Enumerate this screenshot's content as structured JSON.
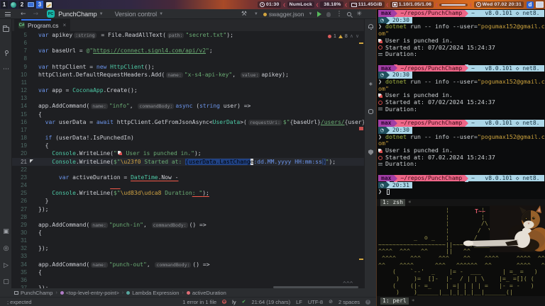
{
  "topbar": {
    "workspaces": [
      {
        "num": "1",
        "icon": "globe-icon",
        "active": false
      },
      {
        "num": "2",
        "icon": "monitor-icon",
        "active": false
      },
      {
        "num": "3",
        "icon": "editor-icon",
        "active": true
      }
    ],
    "status": [
      {
        "icon": "clock-icon",
        "label": "01:30"
      },
      {
        "icon": null,
        "label": "NumLock"
      },
      {
        "icon": "power-icon",
        "label": "38.18%"
      },
      {
        "icon": "disk-icon",
        "label": "111.45GiB"
      },
      {
        "icon": "cpu-icon",
        "label": "1.10/1.05/1.06"
      },
      {
        "icon": "slider-icon",
        "label": ""
      },
      {
        "icon": "clock-icon",
        "label": "Wed 07.02 20:31"
      }
    ],
    "tray": {
      "d_badge": "d"
    }
  },
  "editor": {
    "header": {
      "project": "PunchChamp",
      "project_badge": "PC",
      "vcs": "Version control",
      "run_config": "swagger.json"
    },
    "tab": {
      "name": "Program.cs",
      "close": "×"
    },
    "inspections": {
      "errors": "1",
      "warnings": "8"
    },
    "code": {
      "lines": [
        {
          "n": 5,
          "tokens": [
            [
              "k",
              "var"
            ],
            [
              "v",
              " apikey"
            ],
            [
              "h",
              ":string"
            ],
            [
              "v",
              " = File.ReadAllText("
            ],
            [
              "h",
              "path:"
            ],
            [
              "s",
              "\"secret.txt\""
            ],
            [
              "v",
              ");"
            ]
          ]
        },
        {
          "n": 6,
          "tokens": []
        },
        {
          "n": 7,
          "tokens": [
            [
              "k",
              "var"
            ],
            [
              "v",
              " baseUrl = "
            ],
            [
              "s",
              "@\""
            ],
            [
              "su",
              "https://connect.signl4.com/api/v2"
            ],
            [
              "s",
              "\""
            ],
            [
              "v",
              ";"
            ]
          ]
        },
        {
          "n": 8,
          "tokens": []
        },
        {
          "n": 9,
          "tokens": [
            [
              "k",
              "var"
            ],
            [
              "v",
              " httpClient = "
            ],
            [
              "k",
              "new"
            ],
            [
              "v",
              " "
            ],
            [
              "t",
              "HttpClient"
            ],
            [
              "v",
              "();"
            ]
          ]
        },
        {
          "n": 10,
          "tokens": [
            [
              "v",
              "httpClient.DefaultRequestHeaders.Add("
            ],
            [
              "h",
              "name:"
            ],
            [
              "s",
              "\"x-s4-api-key\""
            ],
            [
              "v",
              ", "
            ],
            [
              "h",
              "value:"
            ],
            [
              "v",
              "apikey);"
            ]
          ]
        },
        {
          "n": 11,
          "tokens": []
        },
        {
          "n": 12,
          "tokens": [
            [
              "k",
              "var"
            ],
            [
              "v",
              " app = "
            ],
            [
              "t",
              "CoconaApp"
            ],
            [
              "v",
              ".Create();"
            ]
          ]
        },
        {
          "n": 13,
          "tokens": []
        },
        {
          "n": 14,
          "tokens": [
            [
              "v",
              "app.AddCommand("
            ],
            [
              "h",
              "name:"
            ],
            [
              "s",
              "\"info\""
            ],
            [
              "v",
              ", "
            ],
            [
              "h",
              "commandBody:"
            ],
            [
              "k",
              "async"
            ],
            [
              "v",
              " ("
            ],
            [
              "k",
              "string"
            ],
            [
              "v",
              " user) =>"
            ]
          ]
        },
        {
          "n": 15,
          "tokens": [
            [
              "v",
              "{"
            ]
          ]
        },
        {
          "n": 16,
          "tokens": [
            [
              "v",
              "  "
            ],
            [
              "k",
              "var"
            ],
            [
              "v",
              " userData = "
            ],
            [
              "k",
              "await"
            ],
            [
              "v",
              " httpClient.GetFromJsonAsync<"
            ],
            [
              "t",
              "UserData"
            ],
            [
              "v",
              ">("
            ],
            [
              "h",
              "requestUri:"
            ],
            [
              "s",
              "$\""
            ],
            [
              "p",
              "{"
            ],
            [
              "v",
              "baseUrl"
            ],
            [
              "p",
              "}"
            ],
            [
              "su",
              "/users/"
            ],
            [
              "p",
              "{"
            ],
            [
              "v",
              "user"
            ],
            [
              "p",
              "}"
            ],
            [
              "s",
              "\""
            ],
            [
              "v",
              ");"
            ]
          ]
        },
        {
          "n": 17,
          "tokens": []
        },
        {
          "n": 18,
          "tokens": [
            [
              "v",
              "  "
            ],
            [
              "k",
              "if"
            ],
            [
              "v",
              " (userData!.IsPunchedIn)"
            ]
          ]
        },
        {
          "n": 19,
          "tokens": [
            [
              "v",
              "  {"
            ]
          ]
        },
        {
          "n": 20,
          "tokens": [
            [
              "v",
              "    "
            ],
            [
              "t",
              "Console"
            ],
            [
              "v",
              ".WriteLine("
            ],
            [
              "s",
              "\""
            ],
            [
              "icon",
              "rocket"
            ],
            [
              "s",
              " User is punched in.\""
            ],
            [
              "v",
              ");"
            ]
          ]
        },
        {
          "n": 21,
          "cur": true,
          "tokens": [
            [
              "v",
              "    "
            ],
            [
              "t",
              "Console"
            ],
            [
              "v",
              ".WriteLine("
            ],
            [
              "s",
              "$\""
            ],
            [
              "e",
              "\\u23f0"
            ],
            [
              "s",
              " Started at: "
            ],
            [
              "sel",
              "{userData.LastChang"
            ],
            [
              "cur",
              "e"
            ],
            [
              "fmt",
              ":dd.MM.yyyy HH:mm:ss"
            ],
            [
              "brm",
              "}"
            ],
            [
              "s",
              "\""
            ],
            [
              "v",
              ");"
            ]
          ]
        },
        {
          "n": 22,
          "tokens": []
        },
        {
          "n": 23,
          "tokens": [
            [
              "v",
              "      "
            ],
            [
              "k",
              "var"
            ],
            [
              "v",
              " activeDuration = "
            ],
            [
              "t err",
              "DateTime"
            ],
            [
              "v err",
              ".Now -"
            ]
          ]
        },
        {
          "n": 24,
          "tokens": [
            [
              "v",
              "                     "
            ],
            [
              "v err",
              "   "
            ]
          ]
        },
        {
          "n": 25,
          "tokens": [
            [
              "v",
              "    "
            ],
            [
              "t",
              "Console"
            ],
            [
              "v",
              ".WriteLine("
            ],
            [
              "s",
              "$\""
            ],
            [
              "e",
              "\\ud83d\\udca8"
            ],
            [
              "s",
              " Duration"
            ],
            [
              "s err",
              ": \""
            ],
            [
              "v err",
              ");"
            ]
          ]
        },
        {
          "n": 26,
          "tokens": [
            [
              "v",
              "  }"
            ]
          ]
        },
        {
          "n": 27,
          "tokens": [
            [
              "v",
              "});"
            ]
          ]
        },
        {
          "n": 28,
          "tokens": []
        },
        {
          "n": 29,
          "tokens": [
            [
              "v",
              "app.AddCommand("
            ],
            [
              "h",
              "name:"
            ],
            [
              "s",
              "\"punch-in\""
            ],
            [
              "v",
              ", "
            ],
            [
              "h",
              "commandBody:"
            ],
            [
              "v",
              "() =>"
            ]
          ]
        },
        {
          "n": 30,
          "tokens": [
            [
              "v",
              "{"
            ]
          ]
        },
        {
          "n": 31,
          "tokens": []
        },
        {
          "n": 32,
          "tokens": [
            [
              "v",
              "});"
            ]
          ]
        },
        {
          "n": 33,
          "tokens": []
        },
        {
          "n": 34,
          "tokens": [
            [
              "v",
              "app.AddCommand("
            ],
            [
              "h",
              "name:"
            ],
            [
              "s",
              "\"punch-out\""
            ],
            [
              "v",
              ", "
            ],
            [
              "h",
              "commandBody:"
            ],
            [
              "v",
              "() =>"
            ]
          ]
        },
        {
          "n": 35,
          "tokens": [
            [
              "v",
              "{"
            ]
          ]
        },
        {
          "n": 36,
          "tokens": []
        },
        {
          "n": 37,
          "tokens": [
            [
              "v",
              "});"
            ]
          ]
        }
      ]
    },
    "breadcrumbs": [
      {
        "icon": "module-icon",
        "label": "PunchChamp"
      },
      {
        "icon": "entry-icon",
        "label": "<top-level-entry-point>",
        "color": "#b07cc6"
      },
      {
        "icon": "lambda-icon",
        "label": "Lambda Expression",
        "color": "#56a8a0"
      },
      {
        "icon": "variable-icon",
        "label": "activeDuration",
        "color": "#e06c75"
      }
    ],
    "status": {
      "left": "; expected",
      "error_summary": "1 error in 1 file",
      "layout": "ly",
      "caret": "21:64 (19 chars)",
      "line_ending": "LF",
      "encoding": "UTF-8",
      "indent": "2 spaces",
      "vim_badge": "V"
    }
  },
  "terminal": {
    "prompt": {
      "user": "max",
      "cwd": "~/repos/PunchChamp",
      "home": "~",
      "dotnet_version": "v8.0.101",
      "framework": "net8.",
      "hex": "◇"
    },
    "command": {
      "caret": "❯ ",
      "program": "dotnet",
      "args": " run -- info --user=",
      "quoted": "\"pogumax152@gmail.c",
      "wrap": "om\""
    },
    "outputs": {
      "punched": "User is punched in.",
      "started_prefix": "Started at: ",
      "duration": "Duration:"
    },
    "blocks": [
      {
        "time": "20:30",
        "date": "07/02/2024 15:24:37"
      },
      {
        "time": "20:30",
        "date": "07/02/2024 15:24:37"
      },
      {
        "time": "20:30",
        "date": "07.02.2024 15:24:37"
      },
      {
        "time": "20:31",
        "cursor": true
      }
    ],
    "tmux_top": "1: zsh",
    "tmux_bottom": "1: perl",
    "tmux_mark": "*",
    "art": {
      "flag": "T~~",
      "rows": [
        "                   ¦         ¦",
        "                   ¦         ¦",
        "                   ¦         /\\",
        "                   ¦        /  \\",
        "          _  o _   ¦       /    \\",
        "~~~~~~~~~~~~~~~~~~~||~~~~~/______\\~~~~~~~~~~~~~",
        "^^^^  ^^^   ^^     ||   ^^       ^^^      ^^^^",
        " ^^^^    ^^^     ^^^    ^^    ^^^^     ^^^^  ^^",
        "^^    ^^^^      ^^^   ^^^^^^  ^^       ^^^^   ^",
        "    (    `--'  _    |= -  ___      | =_ =   )",
        "     )    )=  []-  |-  / | | \\    |=_ =[]( (",
        "    (    (|- =_    | =| | | | =   |- = -   )",
        "     )    )______|__|_|_|_|__|______(|"
      ]
    }
  }
}
